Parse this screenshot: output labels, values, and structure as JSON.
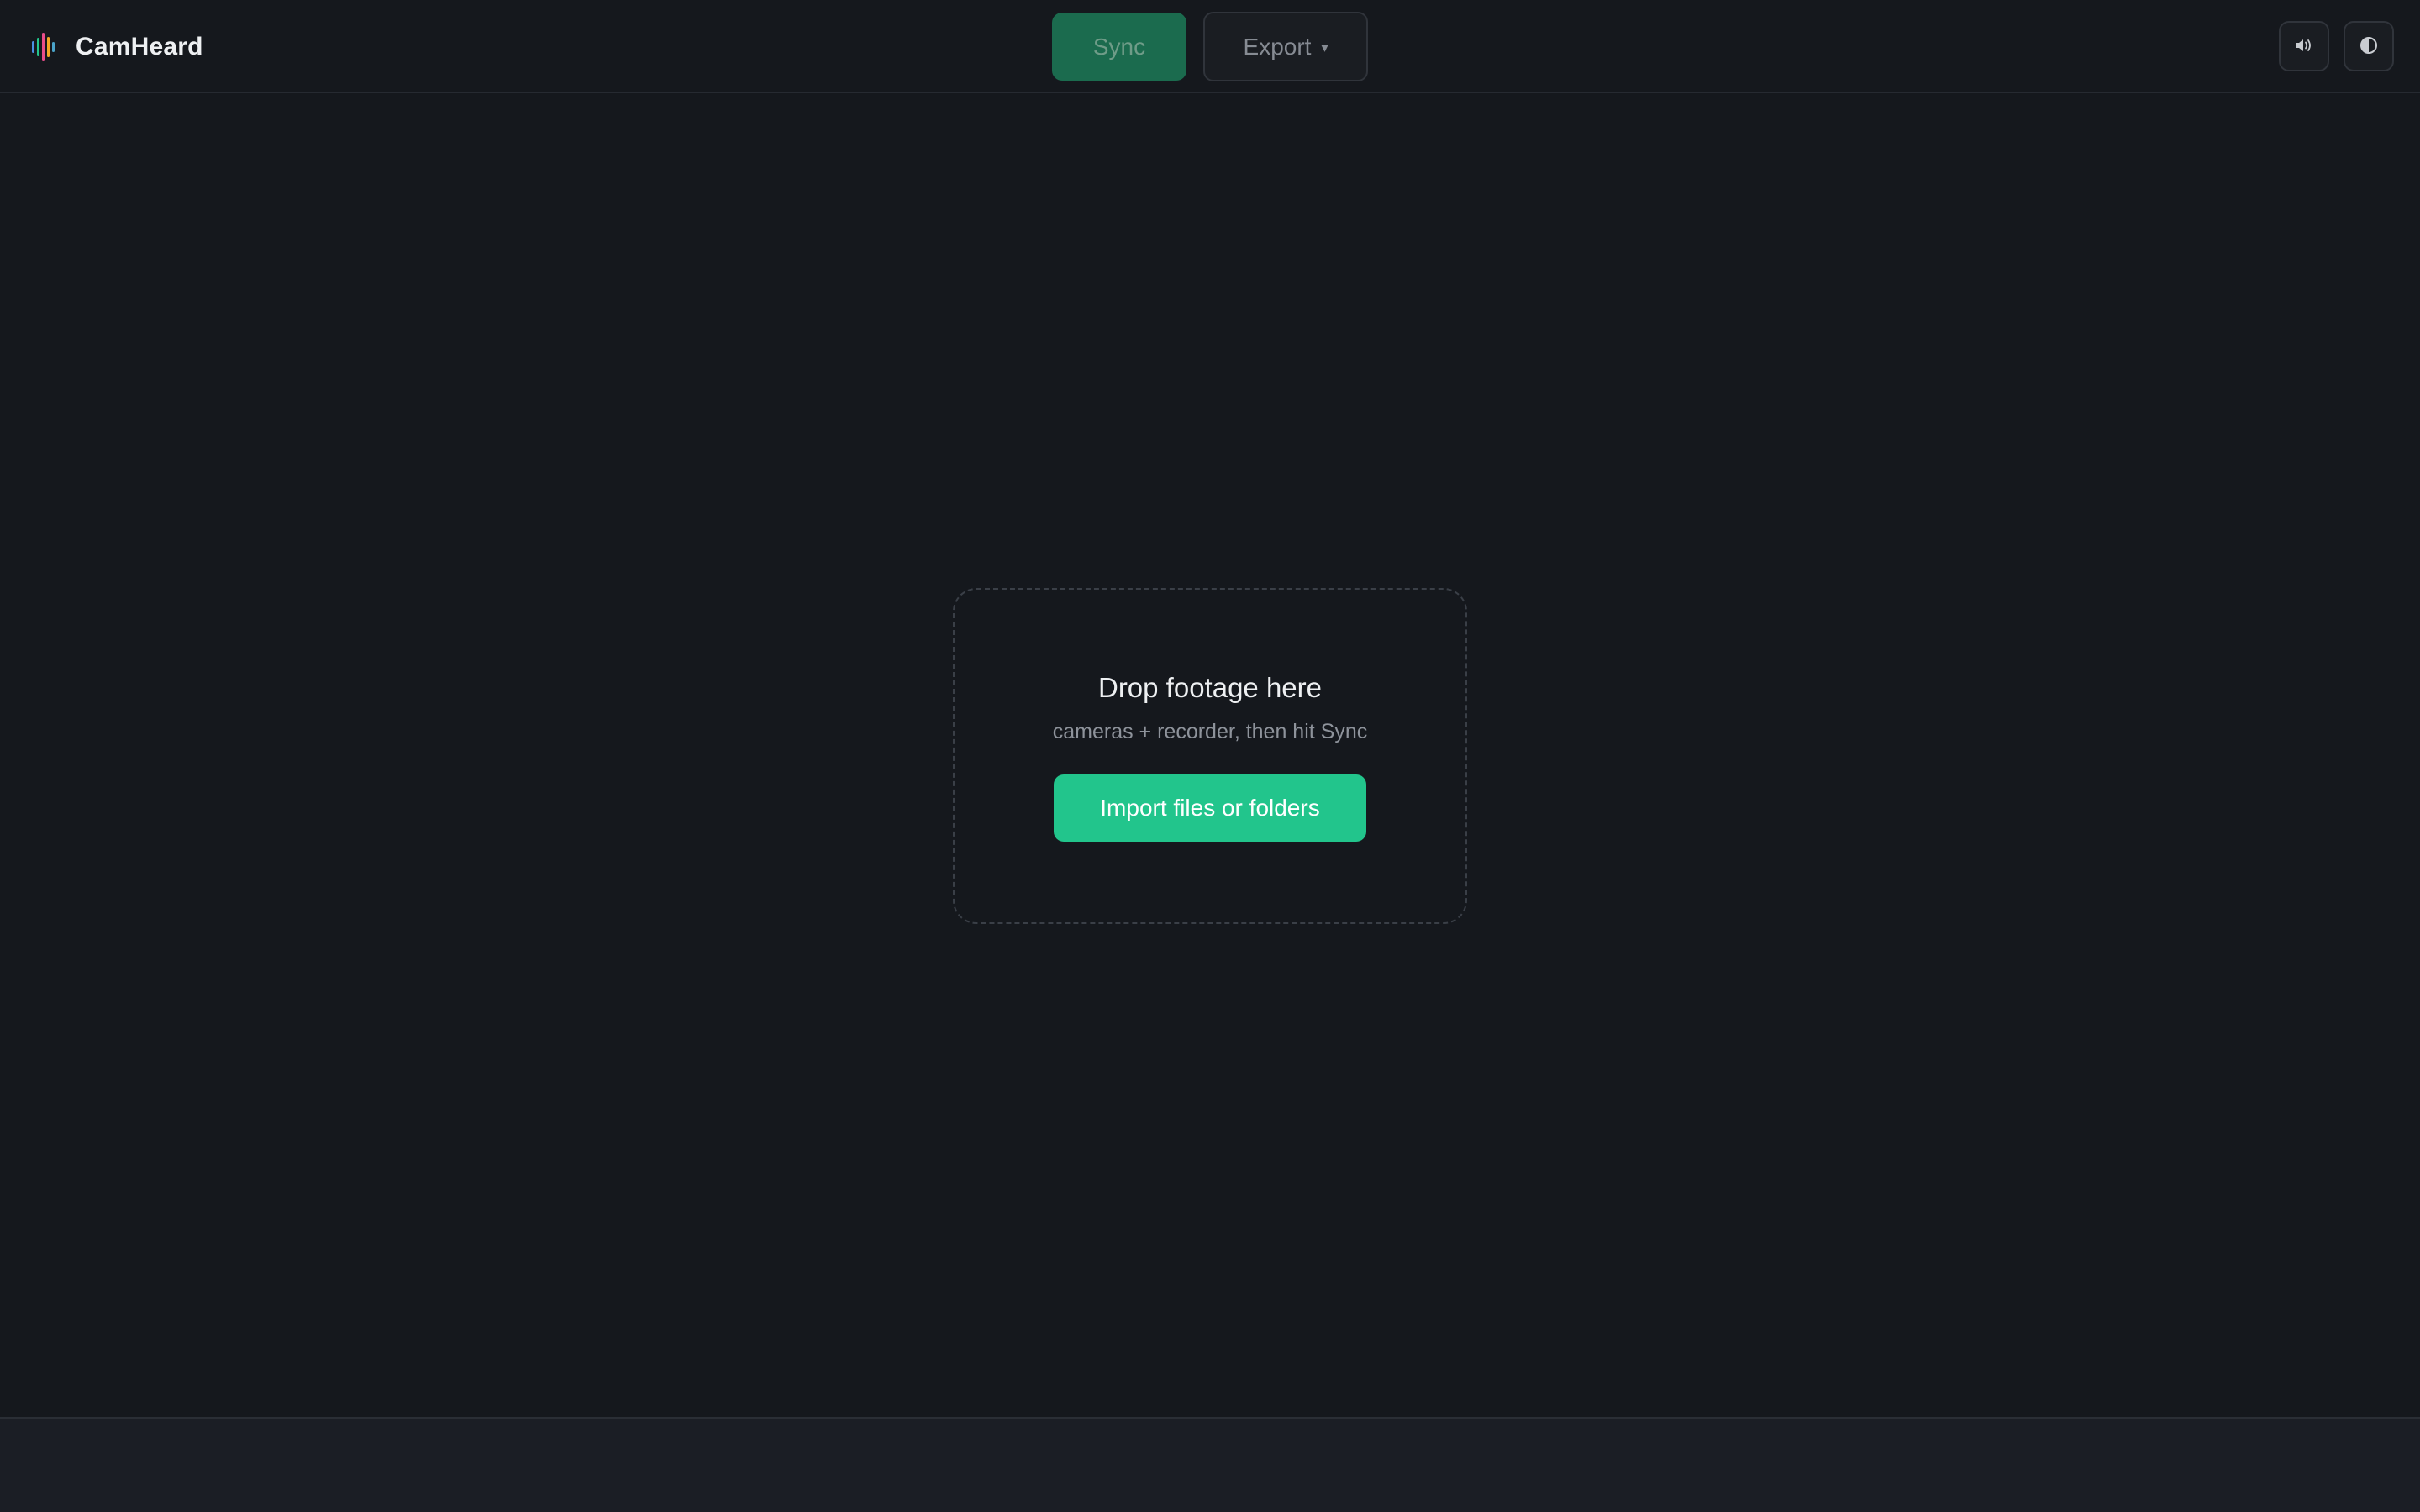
{
  "app": {
    "name": "CamHeard",
    "logo_icon": "waveform-logo-icon"
  },
  "toolbar": {
    "sync_label": "Sync",
    "export_label": "Export",
    "export_caret": "▾",
    "sound_icon": "speaker-icon",
    "theme_icon": "contrast-icon"
  },
  "dropzone": {
    "title": "Drop footage here",
    "subtitle": "cameras + recorder, then hit Sync",
    "import_label": "Import files or folders"
  },
  "colors": {
    "background": "#15181d",
    "accent": "#22c58c",
    "sync_disabled": "#1b6b4e",
    "logo_bars": [
      "#4a90e2",
      "#22c58c",
      "#f5a623",
      "#e84d8a",
      "#4aa3c9"
    ]
  }
}
